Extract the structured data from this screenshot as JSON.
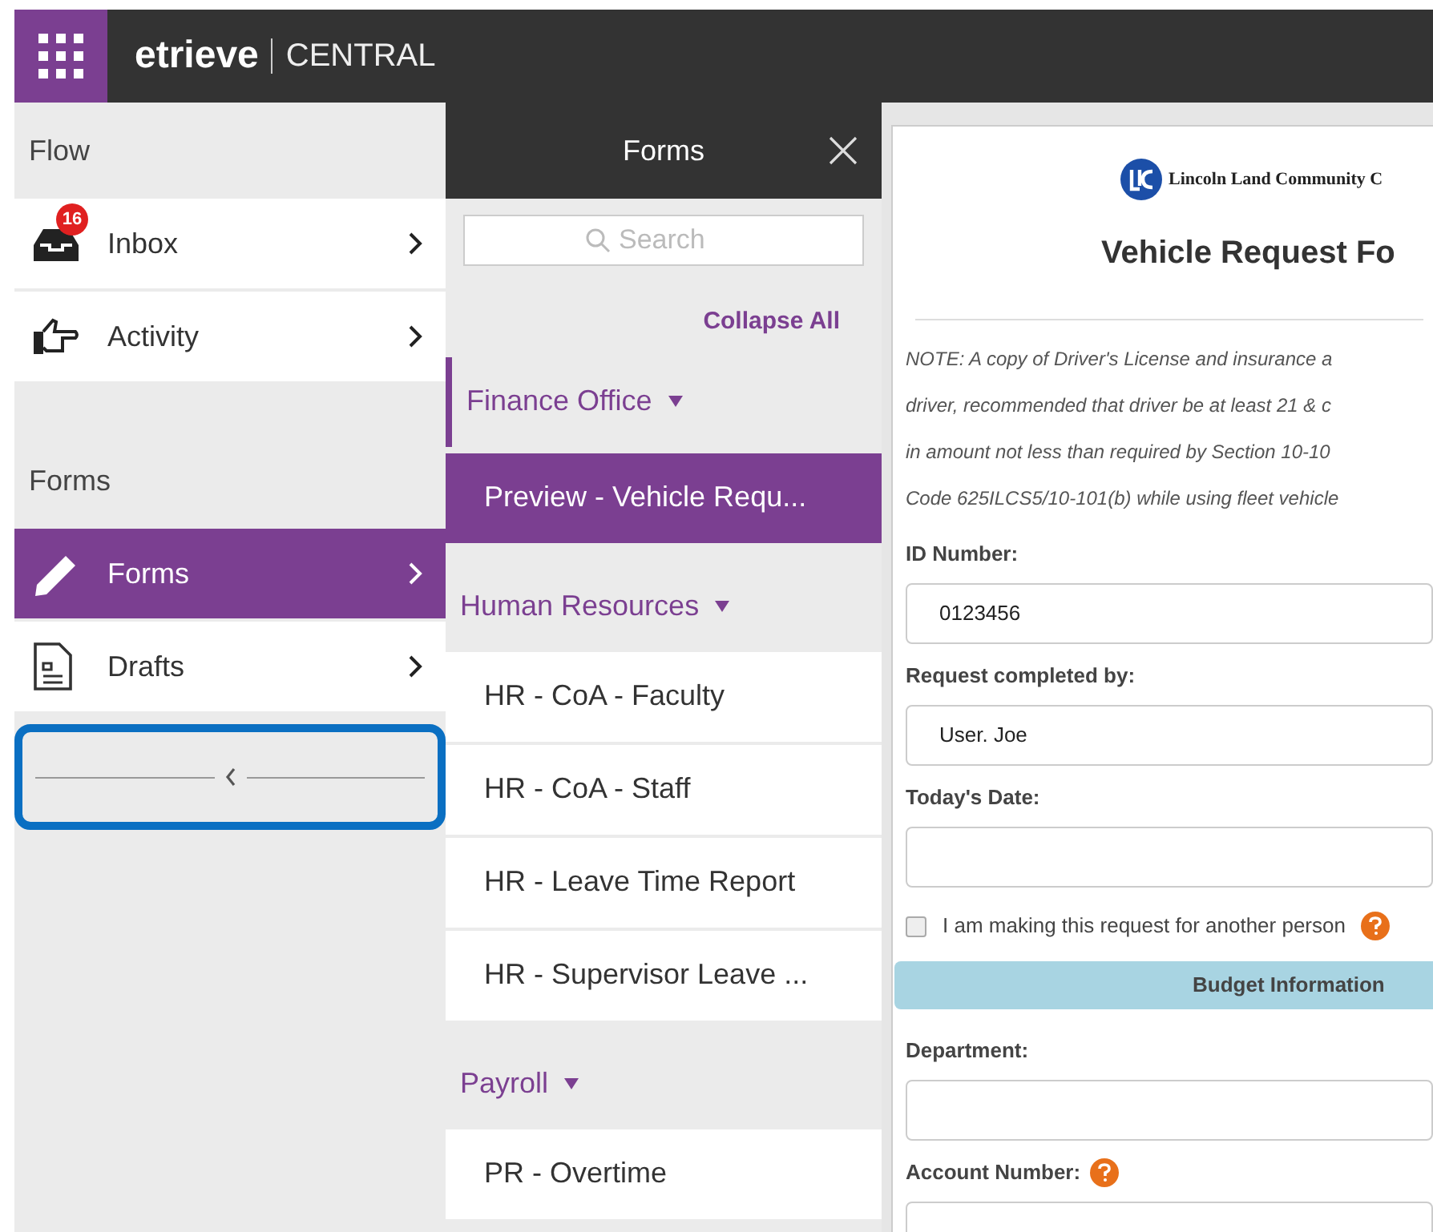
{
  "header": {
    "brand": "etrieve",
    "product": "CENTRAL"
  },
  "sidebar": {
    "sections": [
      {
        "title": "Flow",
        "items": [
          {
            "label": "Inbox",
            "kind": "inbox",
            "badge": "16",
            "selected": false
          },
          {
            "label": "Activity",
            "kind": "activity",
            "selected": false
          }
        ]
      },
      {
        "title": "Forms",
        "items": [
          {
            "label": "Forms",
            "kind": "forms",
            "selected": true
          },
          {
            "label": "Drafts",
            "kind": "drafts",
            "selected": false
          }
        ]
      }
    ],
    "collapse_bar": {
      "highlighted": true
    }
  },
  "forms_panel": {
    "title": "Forms",
    "search": {
      "placeholder": "Search"
    },
    "collapse_all": "Collapse All",
    "groups": [
      {
        "name": "Finance Office",
        "expanded": true,
        "active": true,
        "items": [
          {
            "label": "Preview - Vehicle Requ...",
            "selected": true
          }
        ]
      },
      {
        "name": "Human Resources",
        "expanded": true,
        "active": false,
        "items": [
          {
            "label": "HR - CoA - Faculty",
            "selected": false
          },
          {
            "label": "HR - CoA - Staff",
            "selected": false
          },
          {
            "label": "HR - Leave Time Report",
            "selected": false
          },
          {
            "label": "HR - Supervisor Leave ...",
            "selected": false
          }
        ]
      },
      {
        "name": "Payroll",
        "expanded": true,
        "active": false,
        "items": [
          {
            "label": "PR - Overtime",
            "selected": false
          }
        ]
      }
    ]
  },
  "form_preview": {
    "logo_text": "Lincoln Land Community C",
    "title": "Vehicle Request Fo",
    "note_lines": [
      "NOTE: A copy of Driver's License and insurance a",
      "driver, recommended that driver be at least 21 & c",
      "in amount not less than required by Section 10-10",
      "Code 625ILCS5/10-101(b) while using fleet vehicle"
    ],
    "fields": [
      {
        "kind": "text",
        "label": "ID Number:",
        "value": "0123456",
        "help": false
      },
      {
        "kind": "text",
        "label": "Request completed by:",
        "value": "User. Joe",
        "help": false
      },
      {
        "kind": "text",
        "label": "Today's Date:",
        "help": false
      },
      {
        "kind": "checkbox",
        "label": "I am making this request for another person",
        "checked": false,
        "help": true
      },
      {
        "kind": "section",
        "label": "Budget Information"
      },
      {
        "kind": "text",
        "label": "Department:",
        "help": false
      },
      {
        "kind": "text",
        "label": "Account Number:",
        "help": true
      }
    ]
  }
}
